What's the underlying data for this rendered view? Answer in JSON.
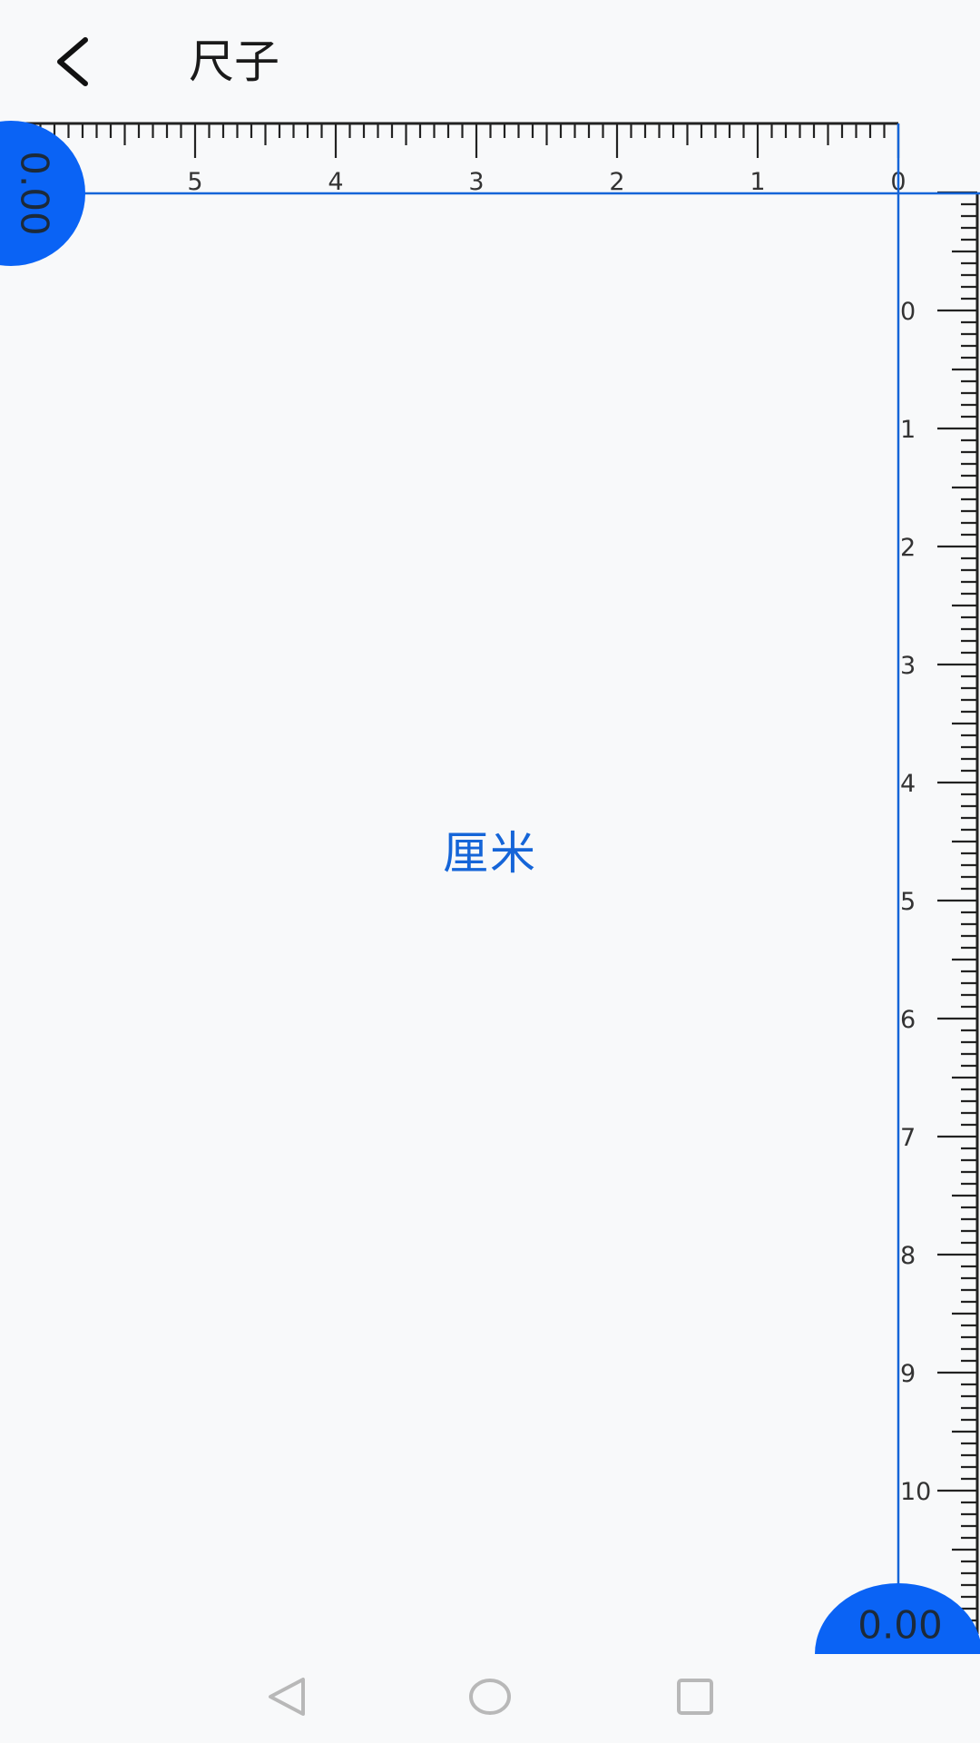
{
  "header": {
    "title": "尺子",
    "back_icon": "chevron-left-icon"
  },
  "ruler": {
    "unit_label": "厘米",
    "horizontal_ticks": [
      "0",
      "1",
      "2",
      "3",
      "4",
      "5"
    ],
    "vertical_ticks": [
      "0",
      "1",
      "2",
      "3",
      "4",
      "5",
      "6",
      "7",
      "8",
      "9",
      "10"
    ],
    "horizontal_reading": "0.00",
    "vertical_reading": "0.00",
    "accent_color": "#1565d8",
    "handle_color": "#0a63f5"
  },
  "nav": {
    "back_icon": "triangle-back-icon",
    "home_icon": "circle-home-icon",
    "recents_icon": "square-recents-icon"
  }
}
